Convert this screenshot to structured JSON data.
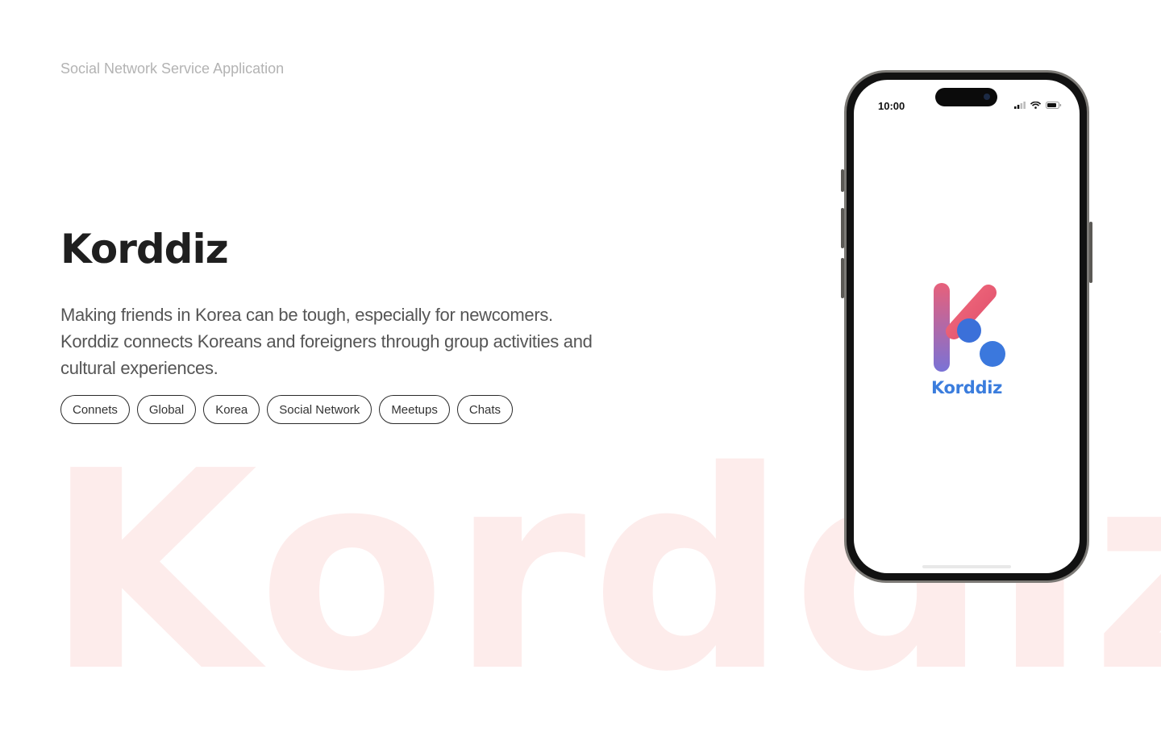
{
  "header": {
    "eyebrow": "Social Network Service Application"
  },
  "hero": {
    "title": "Korddiz",
    "description": "Making friends in Korea can be tough, especially for newcomers. Korddiz connects Koreans and foreigners through group activities and cultural experiences."
  },
  "tags": [
    "Connets",
    "Global",
    "Korea",
    "Social Network",
    "Meetups",
    "Chats"
  ],
  "background_word": "Korddiz",
  "phone": {
    "status_time": "10:00",
    "status_icons": [
      "signal-icon",
      "wifi-icon",
      "battery-icon"
    ],
    "app_name": "Korddiz"
  },
  "colors": {
    "accent": "#3b7ddd",
    "logo_gradient_start": "#e8607a",
    "logo_gradient_end": "#7a72d6",
    "background_word": "#fdeceb"
  }
}
